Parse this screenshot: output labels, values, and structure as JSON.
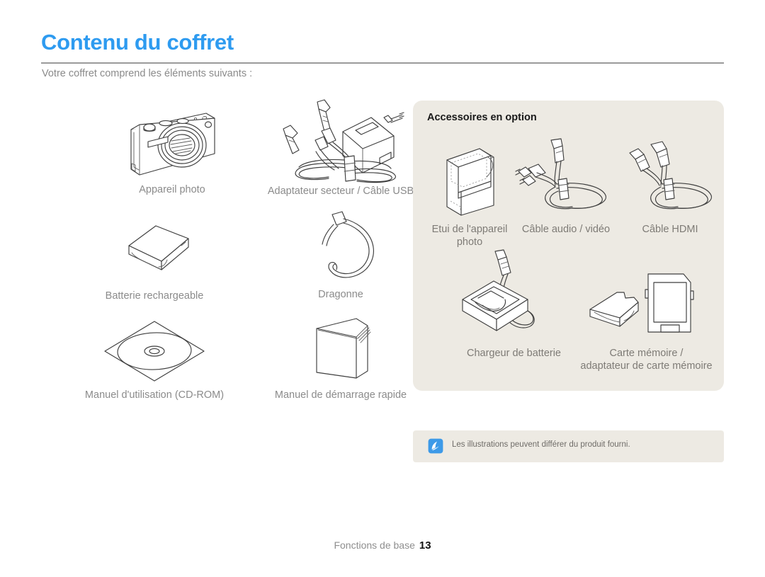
{
  "header": {
    "title": "Contenu du coffret",
    "subtitle": "Votre coffret comprend les éléments suivants :",
    "title_color": "#2e9bf0"
  },
  "included_items": [
    {
      "label": "Appareil photo",
      "icon": "camera-icon"
    },
    {
      "label": "Adaptateur secteur / Câble USB",
      "icon": "ac-adapter-usb-cable-icon"
    },
    {
      "label": "Batterie rechargeable",
      "icon": "battery-icon"
    },
    {
      "label": "Dragonne",
      "icon": "wrist-strap-icon"
    },
    {
      "label": "Manuel d'utilisation (CD-ROM)",
      "icon": "cd-rom-icon"
    },
    {
      "label": "Manuel de démarrage rapide",
      "icon": "quick-start-manual-icon"
    }
  ],
  "optional_panel": {
    "title": "Accessoires en option",
    "background_color": "#edeae3",
    "items": [
      {
        "label": "Etui de l'appareil photo",
        "label_line1": "Etui de l'appareil",
        "label_line2": "photo",
        "icon": "camera-case-icon"
      },
      {
        "label": "Câble audio / vidéo",
        "icon": "av-cable-icon"
      },
      {
        "label": "Câble HDMI",
        "icon": "hdmi-cable-icon"
      },
      {
        "label": "Chargeur de batterie",
        "icon": "battery-charger-icon"
      },
      {
        "label": "Carte mémoire / adaptateur de carte mémoire",
        "label_line1": "Carte mémoire /",
        "label_line2": "adaptateur de carte mémoire",
        "icon": "memory-card-icon"
      }
    ]
  },
  "note": {
    "icon": "note-pen-icon",
    "icon_color": "#3d9ae8",
    "text": "Les illustrations peuvent différer du produit fourni."
  },
  "footer": {
    "chapter": "Fonctions de base",
    "page_number": "13"
  }
}
